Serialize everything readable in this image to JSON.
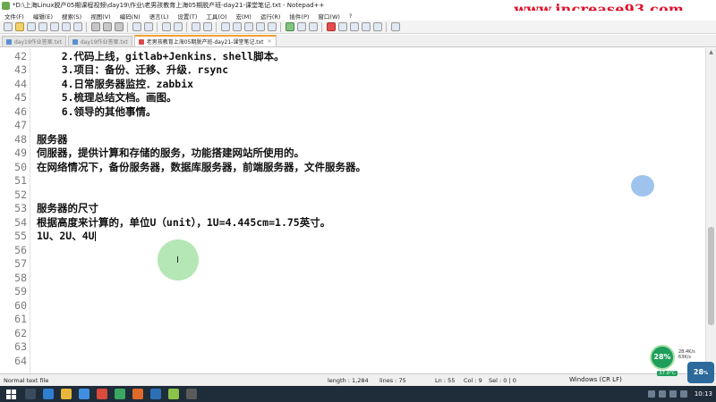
{
  "window": {
    "title": "*D:\\上海Linux脱产05期课程视频\\day19\\作业\\老男孩教育上海05期脱产班-day21-课堂笔记.txt - Notepad++",
    "watermark": "www.increase93.com"
  },
  "menu": {
    "items": [
      "文件(F)",
      "编辑(E)",
      "搜索(S)",
      "视图(V)",
      "编码(N)",
      "语言(L)",
      "设置(T)",
      "工具(O)",
      "宏(M)",
      "运行(R)",
      "插件(P)",
      "窗口(W)",
      "?"
    ]
  },
  "tabs": [
    {
      "label": "day19作业答案.txt",
      "active": false
    },
    {
      "label": "day19作业答案.txt",
      "active": false
    },
    {
      "label": "老男孩教育上海05期脱产班-day21-课堂笔记.txt",
      "active": true
    }
  ],
  "editor": {
    "lines": [
      {
        "num": "42",
        "text": "    2.代码上线，gitlab+Jenkins．shell脚本。"
      },
      {
        "num": "43",
        "text": "    3.项目：备份、迁移、升级．rsync"
      },
      {
        "num": "44",
        "text": "    4.日常服务器监控．zabbix"
      },
      {
        "num": "45",
        "text": "    5.梳理总结文档。画图。"
      },
      {
        "num": "46",
        "text": "    6.领导的其他事情。"
      },
      {
        "num": "47",
        "text": ""
      },
      {
        "num": "48",
        "text": "服务器"
      },
      {
        "num": "49",
        "text": "伺服器，提供计算和存储的服务，功能搭建网站所使用的。"
      },
      {
        "num": "50",
        "text": "在网络情况下，备份服务器，数据库服务器，前端服务器，文件服务器。"
      },
      {
        "num": "51",
        "text": ""
      },
      {
        "num": "52",
        "text": ""
      },
      {
        "num": "53",
        "text": "服务器的尺寸"
      },
      {
        "num": "54",
        "text": "根据高度来计算的，单位U（unit），1U=4.445cm=1.75英寸。"
      },
      {
        "num": "55",
        "text": "1U、2U、4U"
      },
      {
        "num": "56",
        "text": ""
      },
      {
        "num": "57",
        "text": ""
      },
      {
        "num": "58",
        "text": ""
      },
      {
        "num": "59",
        "text": ""
      },
      {
        "num": "60",
        "text": ""
      },
      {
        "num": "61",
        "text": ""
      },
      {
        "num": "62",
        "text": ""
      },
      {
        "num": "63",
        "text": ""
      },
      {
        "num": "64",
        "text": ""
      }
    ],
    "cursor_line": "55"
  },
  "status": {
    "file_type": "Normal text file",
    "length": "length : 1,284",
    "lines": "lines : 75",
    "ln": "Ln : 55",
    "col": "Col : 9",
    "sel": "Sel : 0 | 0",
    "eol": "Windows (CR LF)"
  },
  "widget": {
    "percent": "28%",
    "upload": "28.4K/s",
    "download": "63K/s",
    "temp": "37.0°C",
    "percent2": "28"
  },
  "taskbar": {
    "clock": "10:13"
  },
  "colors": {
    "accent_tab": "#f0a030",
    "watermark": "#e0102a",
    "highlight": "#78d278"
  }
}
